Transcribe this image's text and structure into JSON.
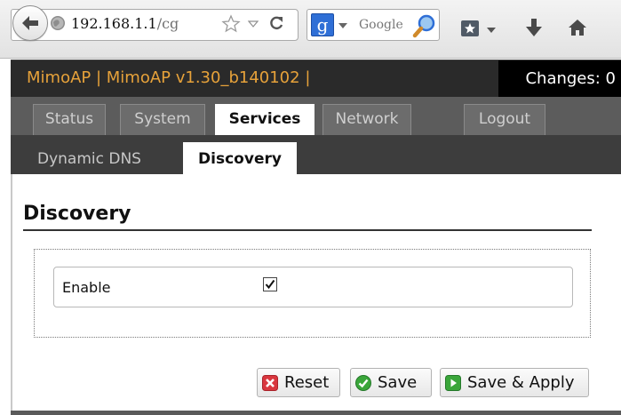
{
  "browser": {
    "url_host": "192.168.1.1",
    "url_path": "/cg",
    "search_placeholder": "Google"
  },
  "header": {
    "brand": "MimoAP | MimoAP v1.30_b140102 |",
    "changes": "Changes: 0"
  },
  "tabs": [
    {
      "label": "Status",
      "active": false
    },
    {
      "label": "System",
      "active": false
    },
    {
      "label": "Services",
      "active": true
    },
    {
      "label": "Network",
      "active": false
    },
    {
      "label": "Logout",
      "active": false
    }
  ],
  "subtabs": [
    {
      "label": "Dynamic DNS",
      "active": false
    },
    {
      "label": "Discovery",
      "active": true
    }
  ],
  "main": {
    "title": "Discovery",
    "enable_label": "Enable",
    "enable_checked": true
  },
  "buttons": {
    "reset": "Reset",
    "save": "Save",
    "save_apply": "Save & Apply"
  },
  "colors": {
    "brand_text": "#e7a23a",
    "header_bg": "#2a2a2a",
    "reset_icon": "#d9363e",
    "save_icon": "#3aa63a"
  }
}
